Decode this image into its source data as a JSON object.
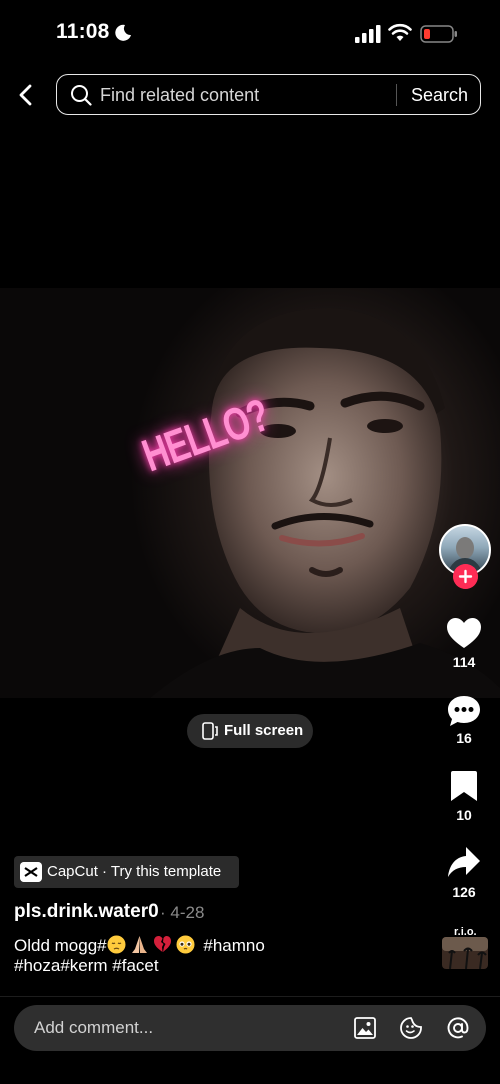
{
  "status": {
    "time": "11:08"
  },
  "nav": {
    "search_placeholder": "Find related content",
    "search_button": "Search"
  },
  "video": {
    "overlay_text": "HELLO?",
    "fullscreen_label": "Full screen"
  },
  "rail": {
    "likes": "114",
    "comments": "16",
    "saves": "10",
    "shares": "126",
    "sound_label": "r.i.o."
  },
  "post": {
    "template_label": "CapCut · Try this template",
    "username": "pls.drink.water0",
    "date": "· 4-28",
    "caption_line1_start": "Oldd mogg#",
    "caption_line1_end": "#hamno",
    "caption_line2": "#hoza#kerm #facet"
  },
  "comment": {
    "placeholder": "Add comment..."
  },
  "colors": {
    "accent": "#fe2c55",
    "overlay_pink": "#ff8fd1",
    "pill_bg": "#2b2b2b"
  }
}
